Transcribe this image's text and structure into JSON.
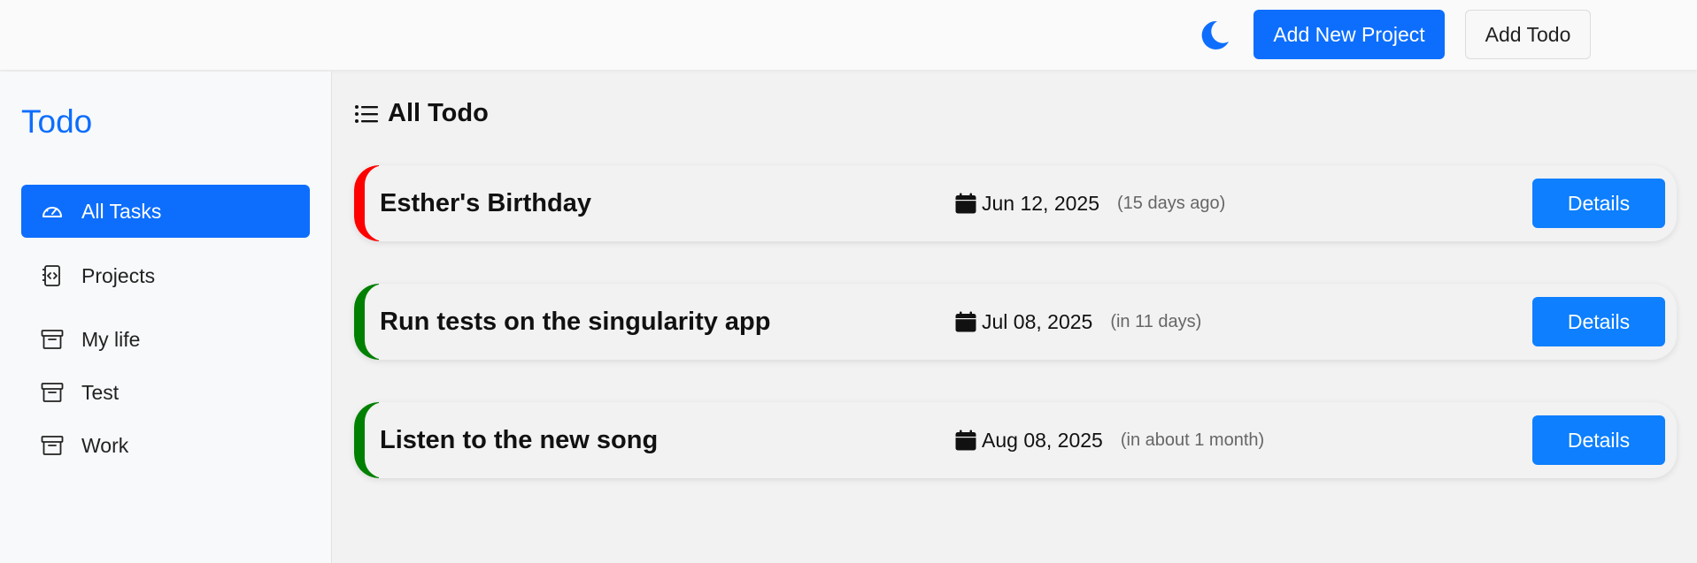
{
  "header": {
    "theme_icon": "moon-icon",
    "add_project_label": "Add New Project",
    "add_todo_label": "Add Todo"
  },
  "sidebar": {
    "brand": "Todo",
    "items": [
      {
        "label": "All Tasks",
        "icon": "speedometer-icon",
        "active": true
      },
      {
        "label": "Projects",
        "icon": "code-file-icon",
        "active": false
      },
      {
        "label": "My life",
        "icon": "archive-icon",
        "active": false
      },
      {
        "label": "Test",
        "icon": "archive-icon",
        "active": false
      },
      {
        "label": "Work",
        "icon": "archive-icon",
        "active": false
      }
    ]
  },
  "main": {
    "title": "All Todo",
    "title_icon": "list-icon",
    "todos": [
      {
        "title": "Esther's Birthday",
        "date": "Jun 12, 2025",
        "relative": "(15 days ago)",
        "accent": "#ff0000",
        "details_label": "Details"
      },
      {
        "title": "Run tests on the singularity app",
        "date": "Jul 08, 2025",
        "relative": "(in 11 days)",
        "accent": "#008000",
        "details_label": "Details"
      },
      {
        "title": "Listen to the new song",
        "date": "Aug 08, 2025",
        "relative": "(in about 1 month)",
        "accent": "#008000",
        "details_label": "Details"
      }
    ]
  },
  "colors": {
    "primary": "#0d6efd",
    "details_button": "#0d7fff"
  }
}
